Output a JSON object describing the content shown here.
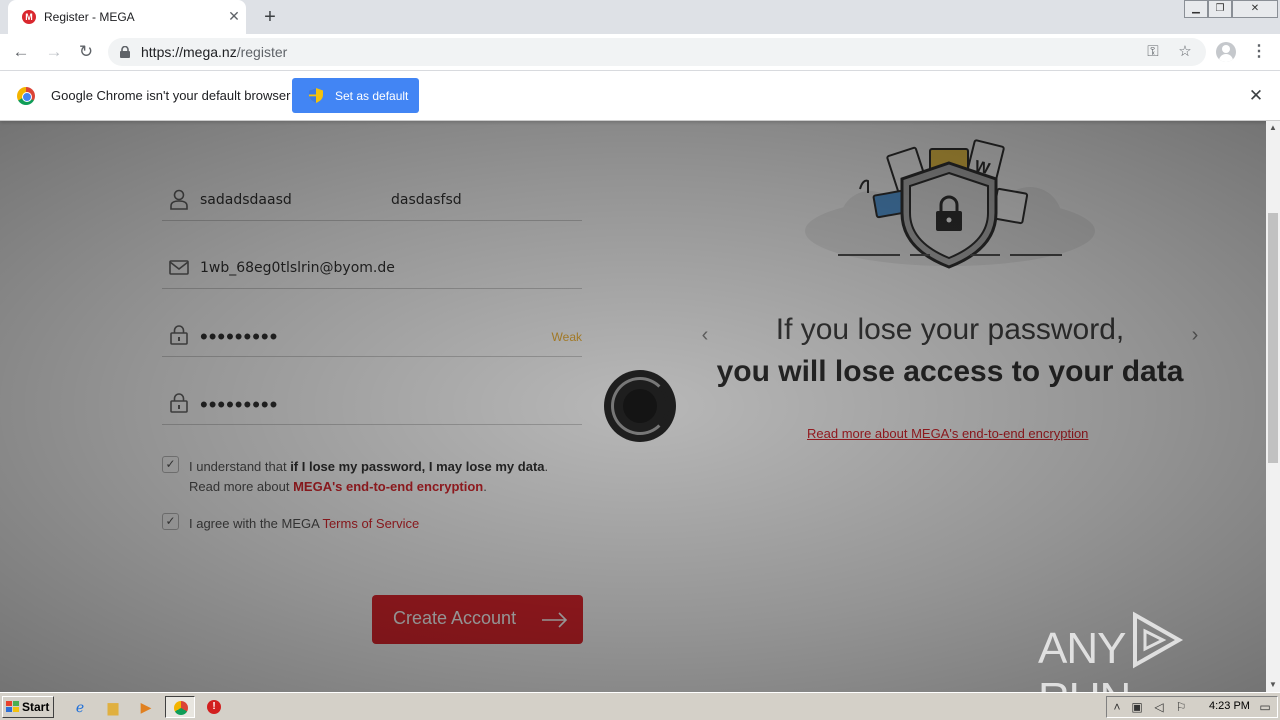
{
  "browser": {
    "tab": {
      "title": "Register - MEGA",
      "favicon_icon": "mega-logo-icon"
    },
    "url": {
      "host": "https://mega.nz",
      "path": "/register"
    },
    "infobar": {
      "message": "Google Chrome isn't your default browser",
      "button_label": "Set as default"
    }
  },
  "form": {
    "first_name": "sadadsdaasd",
    "last_name": "dasdasfsd",
    "email": "1wb_68eg0tlslrin@byom.de",
    "password_mask": "•••••••••",
    "password_confirm_mask": "•••••••••",
    "password_strength": "Weak",
    "checkbox1": {
      "prefix": "I understand that ",
      "bold": "if I lose my password, I may lose my data",
      "suffix": ".",
      "line2_prefix": "Read more about ",
      "line2_link": "MEGA's end-to-end encryption",
      "line2_suffix": "."
    },
    "checkbox2": {
      "prefix": "I agree with the MEGA ",
      "link": "Terms of Service"
    },
    "submit_label": "Create Account"
  },
  "slide": {
    "line1": "If you lose your password,",
    "line2": "you will lose access to your data",
    "link": "Read more about MEGA's end-to-end encryption"
  },
  "watermark": {
    "left": "ANY",
    "right": "RUN"
  },
  "taskbar": {
    "start_label": "Start",
    "clock": "4:23 PM"
  },
  "colors": {
    "brand_red": "#d9272e",
    "chrome_blue": "#4285f4",
    "strength_weak": "#f0b43a"
  }
}
